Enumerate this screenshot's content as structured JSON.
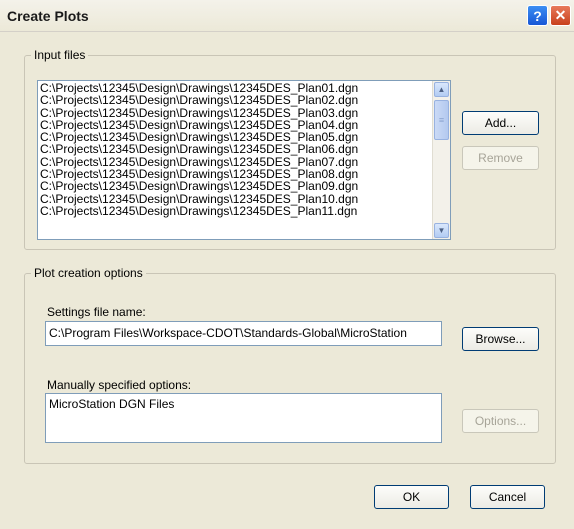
{
  "window": {
    "title": "Create Plots",
    "help_label": "?",
    "close_label": "✕"
  },
  "input_files": {
    "group_label": "Input files",
    "files": [
      "C:\\Projects\\12345\\Design\\Drawings\\12345DES_Plan01.dgn",
      "C:\\Projects\\12345\\Design\\Drawings\\12345DES_Plan02.dgn",
      "C:\\Projects\\12345\\Design\\Drawings\\12345DES_Plan03.dgn",
      "C:\\Projects\\12345\\Design\\Drawings\\12345DES_Plan04.dgn",
      "C:\\Projects\\12345\\Design\\Drawings\\12345DES_Plan05.dgn",
      "C:\\Projects\\12345\\Design\\Drawings\\12345DES_Plan06.dgn",
      "C:\\Projects\\12345\\Design\\Drawings\\12345DES_Plan07.dgn",
      "C:\\Projects\\12345\\Design\\Drawings\\12345DES_Plan08.dgn",
      "C:\\Projects\\12345\\Design\\Drawings\\12345DES_Plan09.dgn",
      "C:\\Projects\\12345\\Design\\Drawings\\12345DES_Plan10.dgn",
      "C:\\Projects\\12345\\Design\\Drawings\\12345DES_Plan11.dgn"
    ],
    "add_label": "Add...",
    "remove_label": "Remove"
  },
  "plot_options": {
    "group_label": "Plot creation options",
    "settings_label": "Settings file name:",
    "settings_value": "C:\\Program Files\\Workspace-CDOT\\Standards-Global\\MicroStation",
    "browse_label": "Browse...",
    "manual_label": "Manually specified options:",
    "manual_value": "MicroStation DGN Files",
    "options_label": "Options..."
  },
  "footer": {
    "ok_label": "OK",
    "cancel_label": "Cancel"
  }
}
